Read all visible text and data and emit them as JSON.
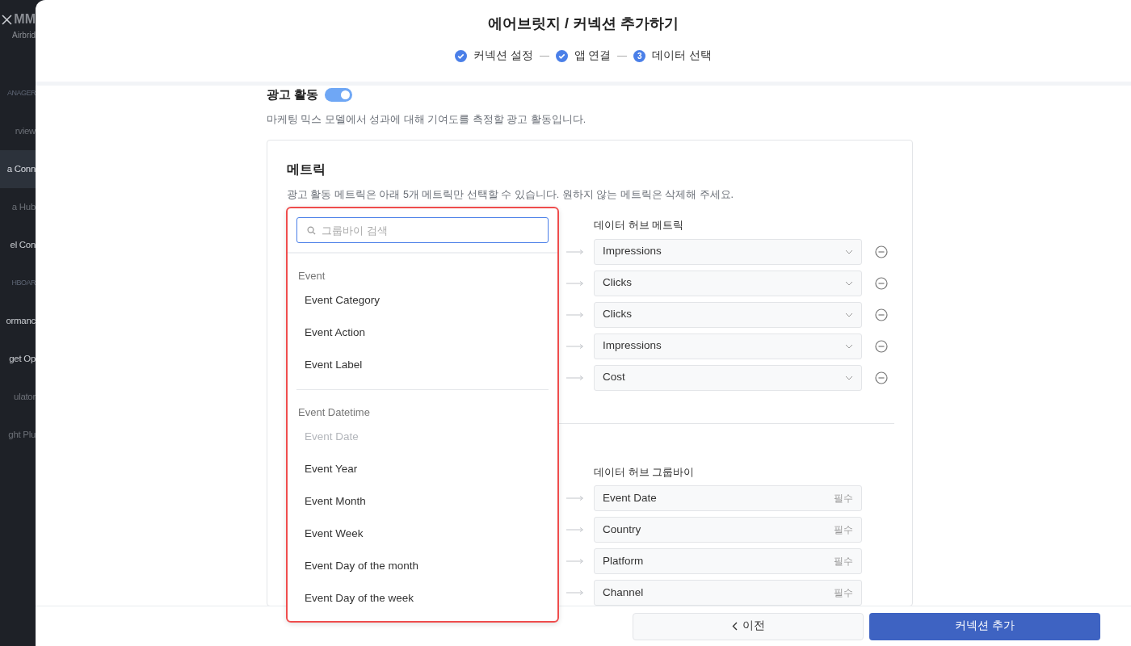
{
  "sidebar": {
    "logo": "MM",
    "logo_subtitle": "Airbrid",
    "items": [
      {
        "kind": "section",
        "label": "ANAGER"
      },
      {
        "kind": "link",
        "label": "rview",
        "selected": false,
        "disabled": true
      },
      {
        "kind": "link",
        "label": "a Conn",
        "selected": true,
        "disabled": false
      },
      {
        "kind": "link",
        "label": "a Hub",
        "selected": false,
        "disabled": true
      },
      {
        "kind": "link",
        "label": "el Con",
        "selected": false,
        "disabled": false
      },
      {
        "kind": "section",
        "label": "HBOAR"
      },
      {
        "kind": "link",
        "label": "ormanc",
        "selected": false,
        "disabled": false
      },
      {
        "kind": "link",
        "label": "get Op",
        "selected": false,
        "disabled": false
      },
      {
        "kind": "link",
        "label": "ulator",
        "selected": false,
        "disabled": true
      },
      {
        "kind": "link",
        "label": "ght Plu",
        "selected": false,
        "disabled": true
      }
    ]
  },
  "modal": {
    "title": "에어브릿지 / 커넥션 추가하기",
    "steps": [
      {
        "label": "커넥션 설정",
        "completed": true
      },
      {
        "label": "앱 연결",
        "completed": true
      },
      {
        "label": "데이터 선택",
        "completed": false,
        "number": "3"
      }
    ]
  },
  "ad_activity": {
    "label": "광고 활동",
    "on": true,
    "description": "마케팅 믹스 모델에서 성과에 대해 기여도를 측정할 광고 활동입니다."
  },
  "metrics": {
    "title": "메트릭",
    "description": "광고 활동 메트릭은 아래 5개 메트릭만 선택할 수 있습니다. 원하지 않는 메트릭은 삭제해 주세요.",
    "target_header": "데이터 허브 메트릭",
    "rows": [
      {
        "value": "Impressions"
      },
      {
        "value": "Clicks"
      },
      {
        "value": "Clicks"
      },
      {
        "value": "Impressions"
      },
      {
        "value": "Cost"
      }
    ]
  },
  "groupby": {
    "target_header": "데이터 허브 그룹바이",
    "rows": [
      {
        "value": "Event Date",
        "tag": "필수"
      },
      {
        "value": "Country",
        "tag": "필수"
      },
      {
        "value": "Platform",
        "tag": "필수"
      },
      {
        "value": "Channel",
        "tag": "필수"
      }
    ]
  },
  "dropdown": {
    "search_placeholder": "그룹바이 검색",
    "groups": [
      {
        "label": "Event",
        "items": [
          {
            "label": "Event Category",
            "disabled": false
          },
          {
            "label": "Event Action",
            "disabled": false
          },
          {
            "label": "Event Label",
            "disabled": false
          }
        ]
      },
      {
        "label": "Event Datetime",
        "items": [
          {
            "label": "Event Date",
            "disabled": true
          },
          {
            "label": "Event Year",
            "disabled": false
          },
          {
            "label": "Event Month",
            "disabled": false
          },
          {
            "label": "Event Week",
            "disabled": false
          },
          {
            "label": "Event Day of the month",
            "disabled": false
          },
          {
            "label": "Event Day of the week",
            "disabled": false
          }
        ]
      }
    ]
  },
  "footer": {
    "back_button": "이전",
    "submit_button": "커넥션 추가"
  }
}
